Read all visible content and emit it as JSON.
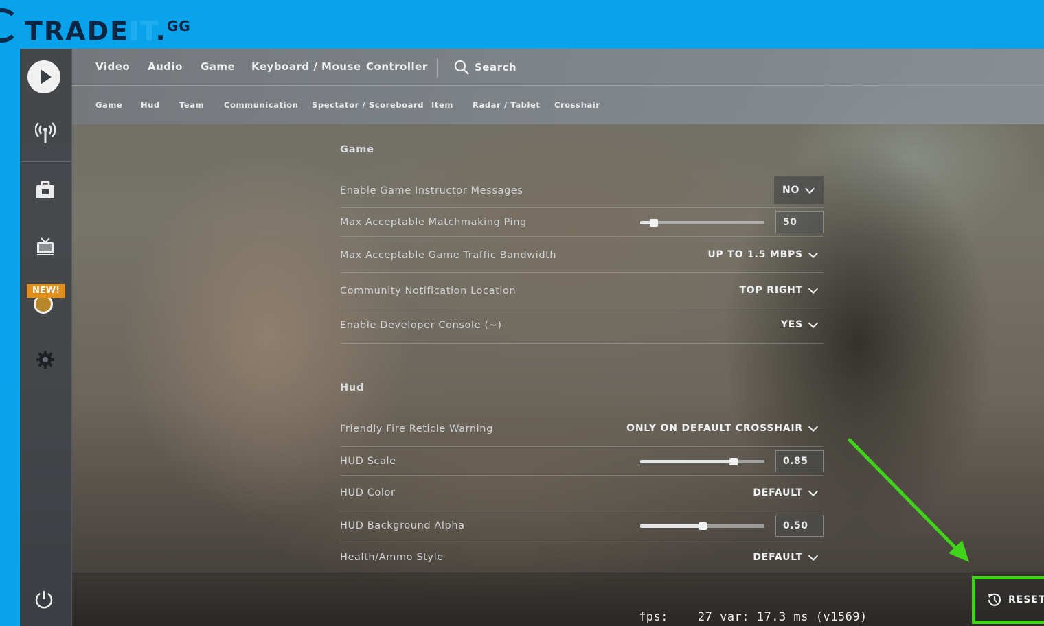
{
  "brand": {
    "part1": "TRADE",
    "part2": "IT",
    "dot": ".",
    "part3": "GG"
  },
  "sidebar": {
    "new_badge": "NEW!"
  },
  "nav": {
    "main_tabs": [
      "Video",
      "Audio",
      "Game",
      "Keyboard / Mouse",
      "Controller"
    ],
    "search_label": "Search",
    "sub_tabs": [
      "Game",
      "Hud",
      "Team",
      "Communication",
      "Spectator / Scoreboard",
      "Item",
      "Radar / Tablet",
      "Crosshair"
    ]
  },
  "sections": {
    "game": {
      "title": "Game",
      "rows": [
        {
          "label": "Enable Game Instructor Messages",
          "type": "dropdown",
          "value": "NO"
        },
        {
          "label": "Max Acceptable Matchmaking Ping",
          "type": "slider",
          "value": "50",
          "fraction": 0.11
        },
        {
          "label": "Max Acceptable Game Traffic Bandwidth",
          "type": "dropdown",
          "value": "UP TO 1.5 MBPS"
        },
        {
          "label": "Community Notification Location",
          "type": "dropdown",
          "value": "TOP RIGHT"
        },
        {
          "label": "Enable Developer Console (~)",
          "type": "dropdown",
          "value": "YES"
        }
      ]
    },
    "hud": {
      "title": "Hud",
      "rows": [
        {
          "label": "Friendly Fire Reticle Warning",
          "type": "dropdown",
          "value": "ONLY ON DEFAULT CROSSHAIR"
        },
        {
          "label": "HUD Scale",
          "type": "slider",
          "value": "0.85",
          "fraction": 0.75
        },
        {
          "label": "HUD Color",
          "type": "dropdown",
          "value": "DEFAULT"
        },
        {
          "label": "HUD Background Alpha",
          "type": "slider",
          "value": "0.50",
          "fraction": 0.5
        },
        {
          "label": "Health/Ammo Style",
          "type": "dropdown",
          "value": "DEFAULT"
        }
      ]
    }
  },
  "footer": {
    "fps_text": "fps:    27 var: 17.3 ms (v1569)",
    "reset_label": "RESET"
  },
  "colors": {
    "brand_blue": "#09a3ec",
    "highlight_green": "#3fd41a",
    "new_badge": "#e08f1a"
  },
  "icons": [
    "logo-emblem",
    "play-icon",
    "broadcast-icon",
    "inventory-icon",
    "tv-icon",
    "operation-icon",
    "gear-icon",
    "power-icon",
    "search-icon",
    "history-icon",
    "chevron-down-icon"
  ]
}
